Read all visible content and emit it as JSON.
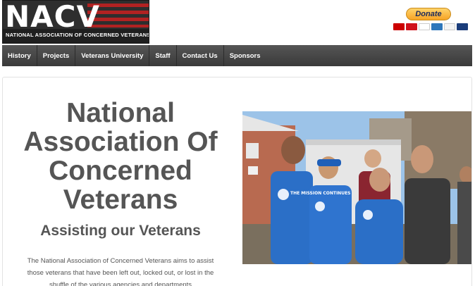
{
  "header": {
    "logo_text": "NACV",
    "logo_subtitle": "NATIONAL ASSOCIATION OF CONCERNED VETERANS",
    "donate_label": "Donate",
    "payment_cards": [
      "MasterCard",
      "Maestro",
      "VISA",
      "AMEX",
      "DISCOVER",
      "BANK"
    ]
  },
  "nav": {
    "items": [
      "History",
      "Projects",
      "Veterans University",
      "Staff",
      "Contact Us",
      "Sponsors"
    ]
  },
  "main": {
    "title": "National Association Of Concerned Veterans",
    "subtitle": "Assisting our Veterans",
    "body": "The National Association of Concerned Veterans aims to assist those veterans that have been left out, locked out, or lost in the shuffle of the various agencies and departments",
    "photo_shirt_text": "THE MISSION CONTINUES"
  }
}
